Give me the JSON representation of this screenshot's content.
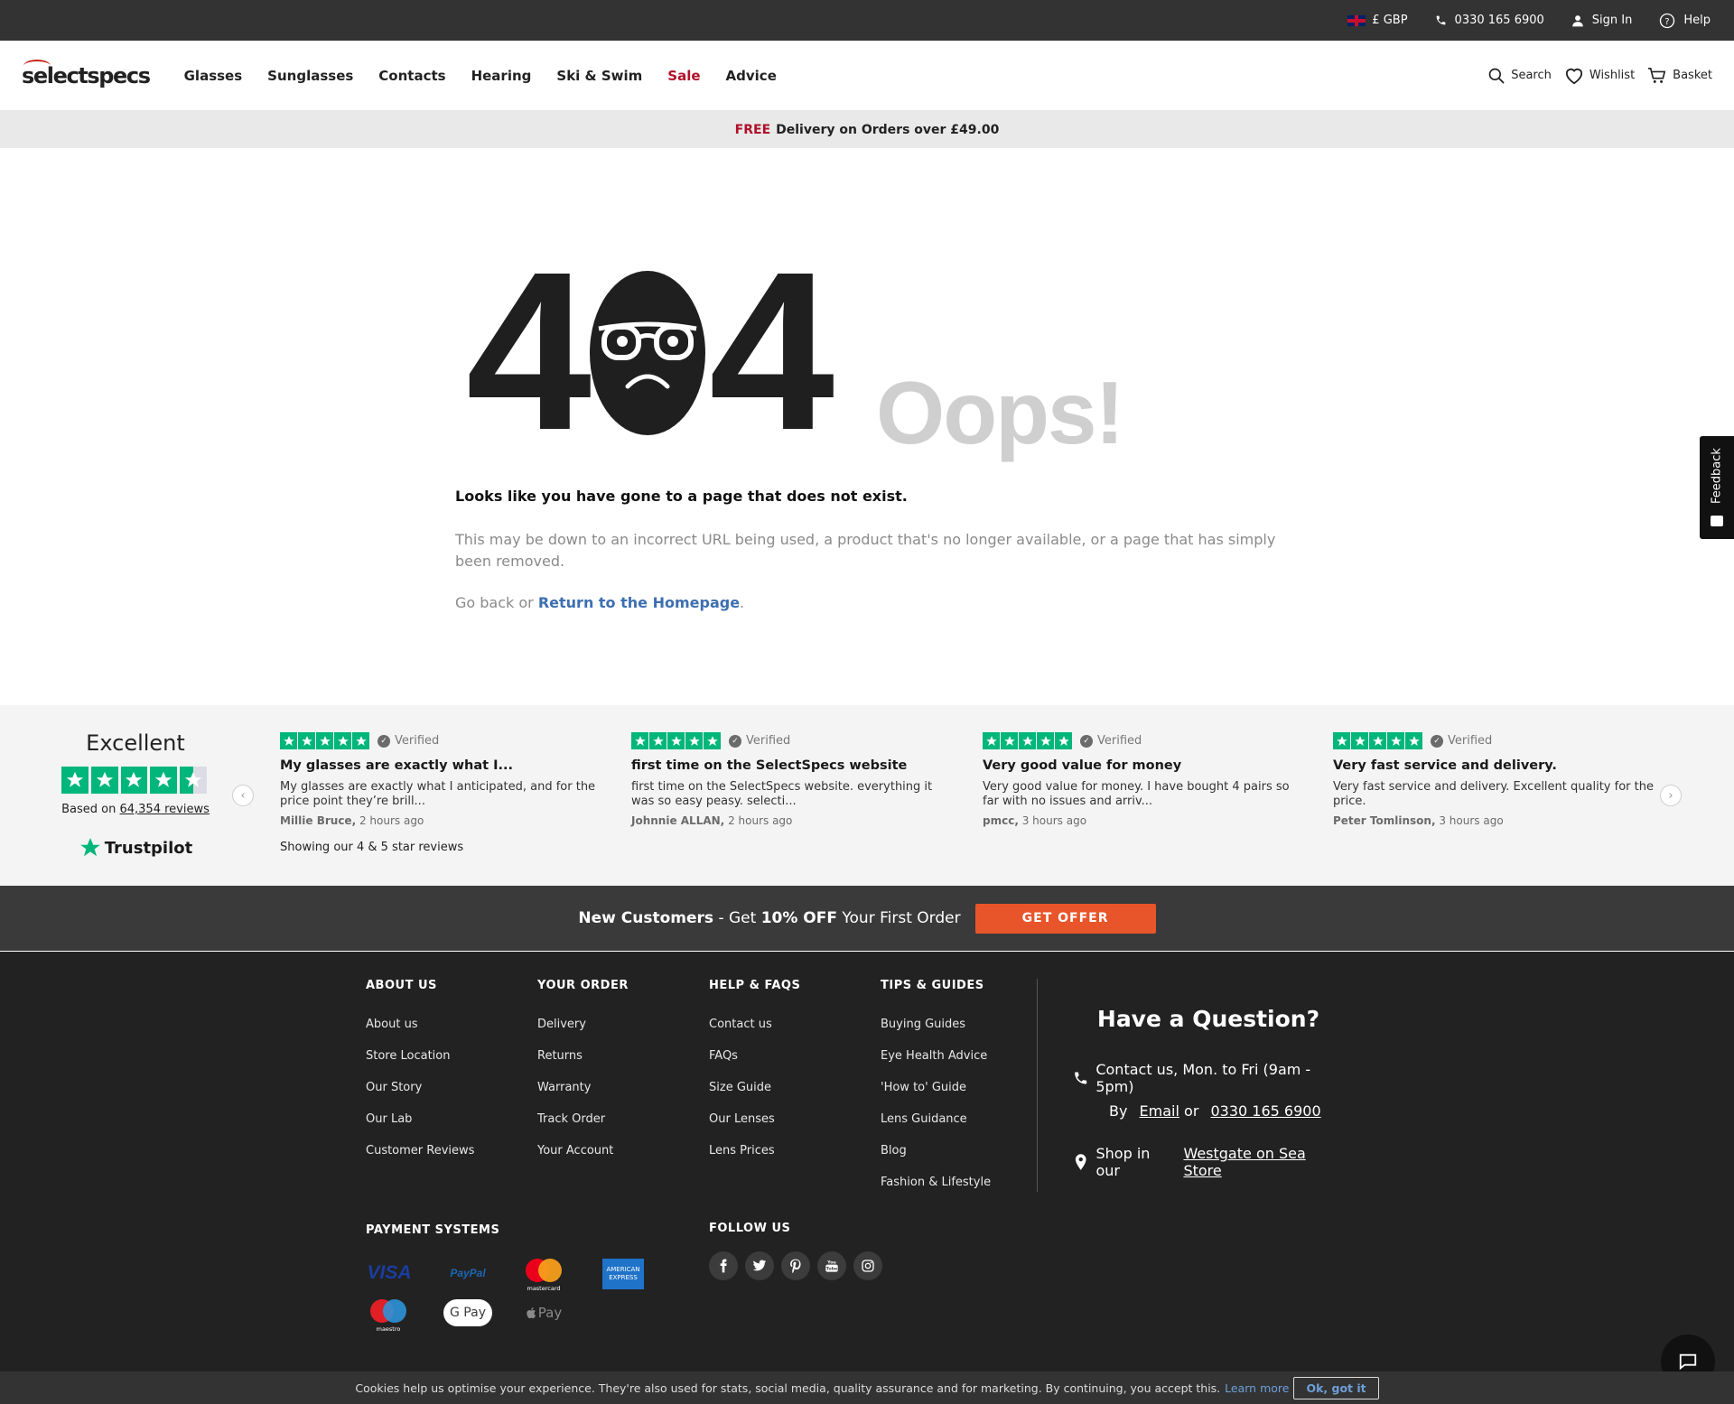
{
  "topbar": {
    "currency": "£ GBP",
    "phone": "0330 165 6900",
    "sign_in": "Sign In",
    "help": "Help"
  },
  "header": {
    "logo": "selectspecs",
    "nav": [
      "Glasses",
      "Sunglasses",
      "Contacts",
      "Hearing",
      "Ski & Swim",
      "Sale",
      "Advice"
    ],
    "search": "Search",
    "wishlist": "Wishlist",
    "basket": "Basket"
  },
  "delivery": {
    "free": "FREE",
    "text": "Delivery on Orders over £49.00"
  },
  "error": {
    "digit_left": "4",
    "digit_right": "4",
    "oops": "Oops!",
    "title": "Looks like you have gone to a page that does not exist.",
    "description": "This may be down to an incorrect URL being used, a product that's no longer available, or a page that has simply been removed.",
    "back_prefix": "Go back or",
    "home_link": "Return to the Homepage",
    "back_suffix": "."
  },
  "trustpilot": {
    "rating_word": "Excellent",
    "based_on": "Based on",
    "review_count": "64,354 reviews",
    "brand": "Trustpilot",
    "showing": "Showing our 4 & 5 star reviews",
    "verified_label": "Verified",
    "stars_rating": 4.5,
    "reviews": [
      {
        "title": "My glasses are exactly what I...",
        "body": "My glasses are exactly what I anticipated, and for the price point they’re brill...",
        "author": "Millie Bruce,",
        "time": "2 hours ago"
      },
      {
        "title": "first time on the SelectSpecs website",
        "body": "first time on the SelectSpecs website. everything it was so easy peasy. selecti...",
        "author": "Johnnie ALLAN,",
        "time": "2 hours ago"
      },
      {
        "title": "Very good value for money",
        "body": "Very good value for money. I have bought 4 pairs so far with no issues and arriv...",
        "author": "pmcc,",
        "time": "3 hours ago"
      },
      {
        "title": "Very fast service and delivery.",
        "body": "Very fast service and delivery. Excellent quality for the price.",
        "author": "Peter Tomlinson,",
        "time": "3 hours ago"
      }
    ]
  },
  "offer": {
    "new_customers": "New Customers",
    "get": " - Get ",
    "discount": "10% OFF",
    "rest": " Your First Order",
    "button": "GET OFFER"
  },
  "footer": {
    "columns": [
      {
        "heading": "ABOUT US",
        "links": [
          "About us",
          "Store Location",
          "Our Story",
          "Our Lab",
          "Customer Reviews"
        ]
      },
      {
        "heading": "YOUR ORDER",
        "links": [
          "Delivery",
          "Returns",
          "Warranty",
          "Track Order",
          "Your Account"
        ]
      },
      {
        "heading": "HELP & FAQS",
        "links": [
          "Contact us",
          "FAQs",
          "Size Guide",
          "Our Lenses",
          "Lens Prices"
        ]
      },
      {
        "heading": "TIPS & GUIDES",
        "links": [
          "Buying Guides",
          "Eye Health Advice",
          "'How to' Guide",
          "Lens Guidance",
          "Blog",
          "Fashion & Lifestyle"
        ]
      }
    ],
    "question": {
      "title": "Have a Question?",
      "contact": "Contact us, Mon. to Fri (9am - 5pm)",
      "by": "By",
      "email": "Email",
      "or": "or",
      "phone": "0330 165 6900",
      "shop_prefix": "Shop in our",
      "store": "Westgate on Sea Store"
    },
    "payment_title": "PAYMENT SYSTEMS",
    "payments": {
      "visa": "VISA",
      "paypal": "PayPal",
      "mastercard": "mastercard",
      "amex": "AMERICAN EXPRESS",
      "maestro": "maestro",
      "gpay": "G Pay",
      "applepay": "Pay"
    },
    "follow_title": "FOLLOW US",
    "social": [
      "facebook-icon",
      "twitter-icon",
      "pinterest-icon",
      "youtube-icon",
      "instagram-icon"
    ]
  },
  "feedback": "Feedback",
  "cookie": {
    "text": "Cookies help us optimise your experience. They're also used for stats, social media, quality assurance and for marketing. By continuing, you accept this.",
    "learn_more": "Learn more",
    "button": "Ok, got it"
  },
  "colors": {
    "accent_red": "#b0102a",
    "trustpilot_green": "#00b67a",
    "offer_orange": "#e8552a",
    "link_blue": "#3d6fb0"
  }
}
